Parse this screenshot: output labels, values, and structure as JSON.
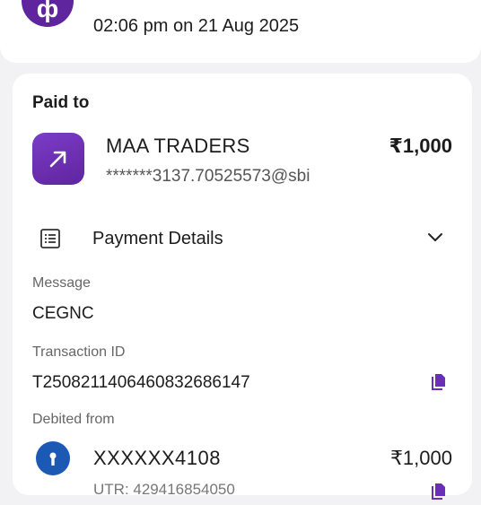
{
  "header": {
    "logo_glyph": "ф",
    "timestamp": "02:06 pm on 21 Aug 2025"
  },
  "paid_to": {
    "label": "Paid to",
    "merchant_name": "MAA TRADERS",
    "upi_id": "*******3137.70525573@sbi",
    "amount": "₹1,000",
    "icon": "arrow-up-right-icon"
  },
  "payment_details": {
    "label": "Payment Details",
    "icon": "receipt-list-icon",
    "expand_icon": "chevron-down-icon"
  },
  "message": {
    "label": "Message",
    "value": "CEGNC"
  },
  "transaction": {
    "label": "Transaction ID",
    "value": "T2508211406460832686147",
    "copy_icon": "copy-icon"
  },
  "debited_from": {
    "label": "Debited from",
    "account": "XXXXXX4108",
    "amount": "₹1,000",
    "utr_partial": "UTR: 429416854050"
  },
  "colors": {
    "brand": "#5f259f",
    "bank": "#1c59b5",
    "background": "#f2f2f4"
  }
}
